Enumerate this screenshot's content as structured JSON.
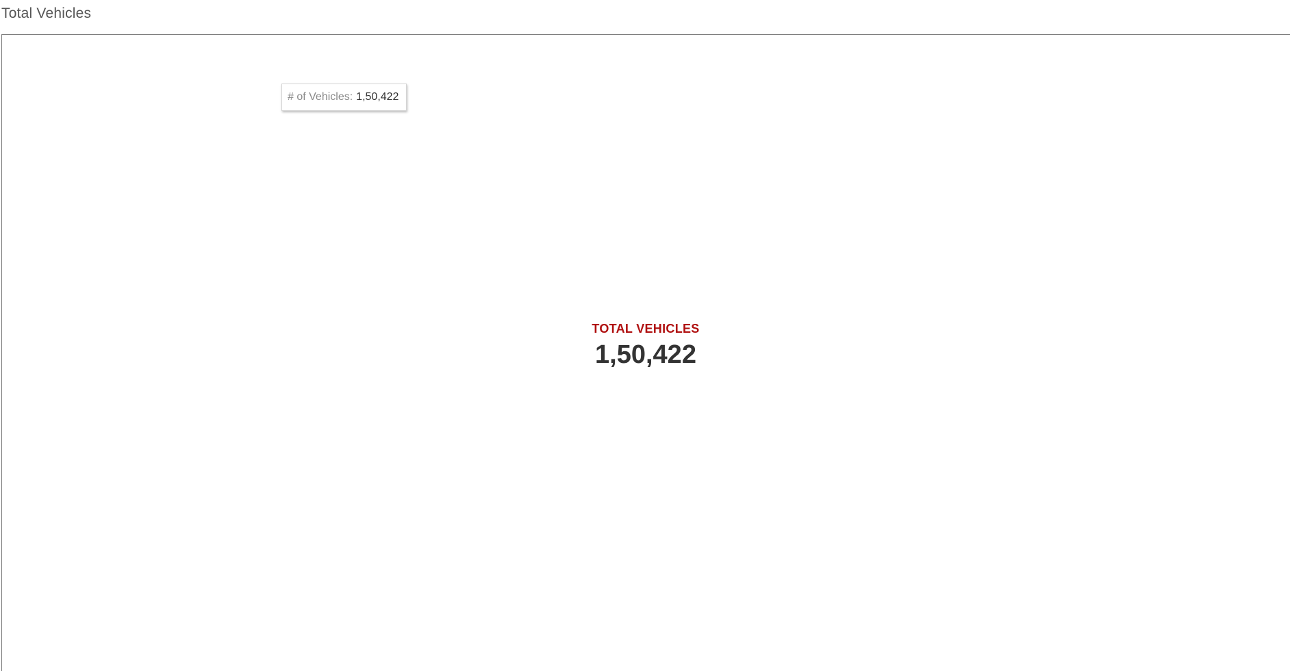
{
  "sheet": {
    "title": "Total Vehicles"
  },
  "tooltip": {
    "label": "# of Vehicles:",
    "value": "1,50,422"
  },
  "kpi": {
    "label": "TOTAL VEHICLES",
    "value": "1,50,422",
    "label_color": "#b01010"
  }
}
